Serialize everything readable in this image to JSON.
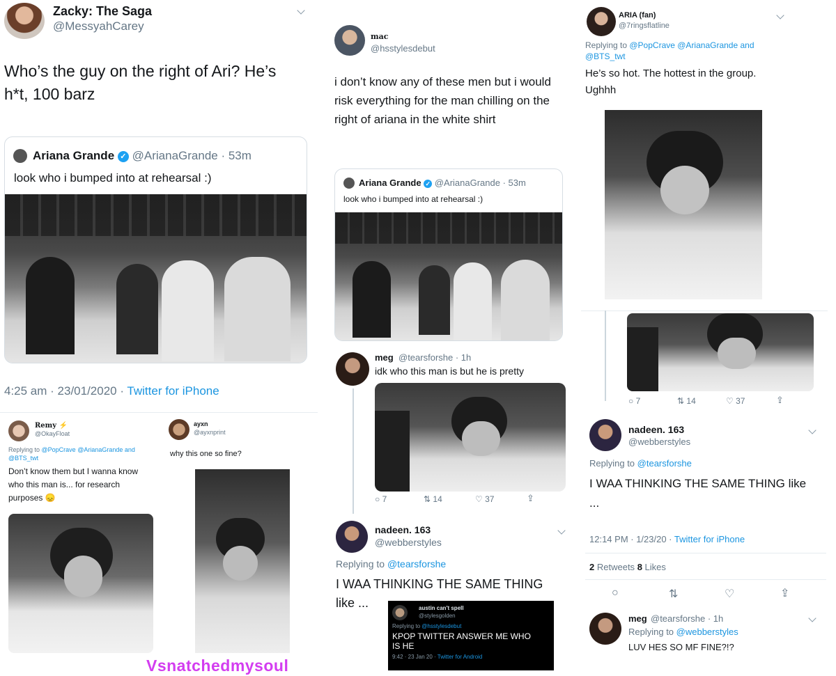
{
  "tweet1": {
    "name": "Zacky: The Saga",
    "handle": "@MessyahCarey",
    "text": "Who’s the guy on the right of Ari? He’s h*t, 100 barz",
    "quote": {
      "name": "Ariana Grande",
      "handle": "@ArianaGrande",
      "time": "· 53m",
      "text": "look who i bumped into at rehearsal :)"
    },
    "timestamp": "4:25 am · 23/01/2020 · ",
    "client": "Twitter for iPhone"
  },
  "remy": {
    "name": "Remy ⚡",
    "handle": "@OkayFloat",
    "reply_prefix": "Replying to ",
    "reply_to": "@PopCrave @ArianaGrande and @BTS_twt",
    "text": "Don’t know them but I wanna know who this man is... for research purposes 😞"
  },
  "ayxn": {
    "name": "ayxn",
    "handle": "@ayxnprint",
    "text": "why this one so fine?"
  },
  "watermark": "Vsnatchedmysoul",
  "mac": {
    "name": "mac",
    "handle": "@hsstylesdebut",
    "text": "i don’t know any of these men but i would risk everything for the man chilling on the right of ariana in the white shirt",
    "quote": {
      "name": "Ariana Grande",
      "handle": "@ArianaGrande",
      "time": "· 53m",
      "text": "look who i bumped into at rehearsal :)"
    }
  },
  "meg1": {
    "name": "meg",
    "handle": "@tearsforshe · 1h",
    "text": "idk who this man is but he is pretty",
    "actions": {
      "reply": "7",
      "retweet": "14",
      "like": "37"
    }
  },
  "nadeen1": {
    "name": "nadeen. 163",
    "handle": "@webberstyles",
    "reply_prefix": "Replying to ",
    "reply_to": "@tearsforshe",
    "text": "I WAA THINKING THE SAME THING like ..."
  },
  "austin": {
    "name": "austin can't spell",
    "handle": "@stylesgolden",
    "reply_prefix": "Replying to ",
    "reply_to": "@hsstylesdebut",
    "text": "KPOP TWITTER ANSWER ME WHO IS HE",
    "time": "9:42 · 23 Jan 20 · ",
    "client": "Twitter for Android"
  },
  "aria": {
    "name": "ARIA (fan)",
    "handle": "@7ringsflatline",
    "reply_prefix": "Replying to ",
    "reply_to": "@PopCrave @ArianaGrande and @BTS_twt",
    "text": "He’s so hot. The hottest in the group. Ughhh",
    "actions": {
      "reply": "7",
      "retweet": "14",
      "like": "37"
    }
  },
  "nadeen2": {
    "name": "nadeen. 163",
    "handle": "@webberstyles",
    "reply_prefix": "Replying to ",
    "reply_to": "@tearsforshe",
    "text": "I WAA THINKING THE SAME THING like ...",
    "timestamp": "12:14 PM · 1/23/20 · ",
    "client": "Twitter for iPhone",
    "retweets": "2",
    "retweets_label": "Retweets",
    "likes": "8",
    "likes_label": "Likes"
  },
  "meg2": {
    "name": "meg",
    "handle": "@tearsforshe · 1h",
    "reply_prefix": "Replying to ",
    "reply_to": "@webberstyles",
    "text": "LUV HES SO MF FINE?!?"
  },
  "colors": {
    "link": "#1b95e0",
    "muted": "#657786",
    "watermark": "#d33df0",
    "verified": "#1da1f2"
  },
  "icons": [
    "chevron-down-icon",
    "verified-icon",
    "reply-icon",
    "retweet-icon",
    "like-icon",
    "share-icon"
  ]
}
